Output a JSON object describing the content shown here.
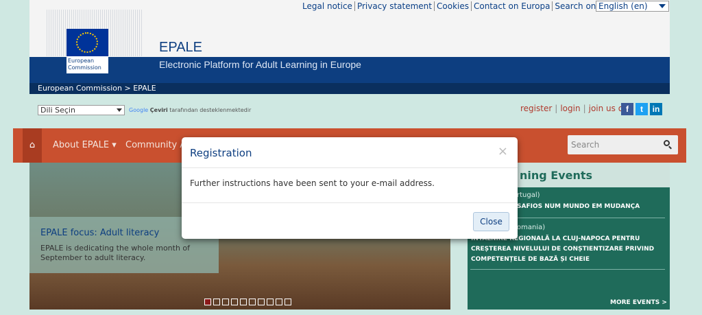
{
  "top_links": [
    "Legal notice",
    "Privacy statement",
    "Cookies",
    "Contact on Europa",
    "Search on Europa"
  ],
  "language": {
    "selected": "English (en)"
  },
  "logo": {
    "line1": "European",
    "line2": "Commission"
  },
  "site": {
    "title": "EPALE",
    "subtitle": "Electronic Platform for Adult Learning in Europe"
  },
  "breadcrumb": "European Commission > EPALE",
  "translate": {
    "select_label": "Dili Seçin",
    "google_word": "Google",
    "ceviri": "Çeviri",
    "powered": "tarafından desteklenmektedir"
  },
  "account": {
    "register": "register",
    "login": "login",
    "join": "join us on"
  },
  "social": {
    "facebook": "f",
    "twitter": "t",
    "linkedin": "in"
  },
  "nav": {
    "home_icon": "⌂",
    "about": "About EPALE ▾",
    "community": "Community Ac"
  },
  "search": {
    "placeholder": "Search"
  },
  "hero": {
    "title": "EPALE focus: Adult literacy",
    "text": "EPALE is dedicating the whole month of September to adult literacy."
  },
  "events": {
    "heading": "ning Events",
    "items": [
      {
        "location": "rtugal)",
        "title": "SAFIOS NUM MUNDO EM MUDANÇA"
      },
      {
        "location": "omania)",
        "title": "ÎNTÂLNIRE REGIONALĂ LA CLUJ-NAPOCA PENTRU CREȘTEREA NIVELULUI DE CONȘTIENTIZARE PRIVIND COMPETENȚELE DE BAZĂ ȘI CHEIE"
      }
    ],
    "more": "MORE EVENTS >"
  },
  "modal": {
    "title": "Registration",
    "close_x": "×",
    "message": "Further instructions have been sent to your e-mail address.",
    "close_button": "Close"
  }
}
